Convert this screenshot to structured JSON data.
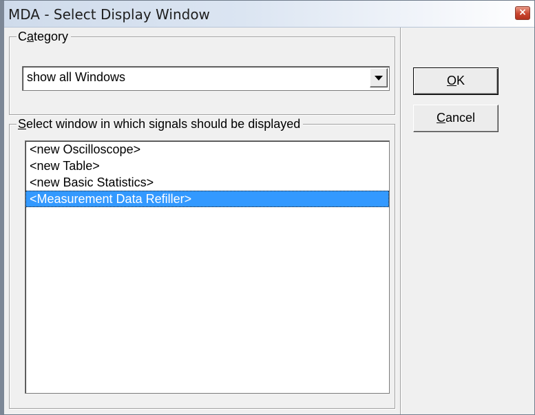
{
  "window": {
    "title": "MDA - Select Display Window",
    "close_glyph": "×"
  },
  "category": {
    "label_prefix": "C",
    "label_mnemonic": "a",
    "label_rest": "tegory",
    "selected_value": "show all Windows"
  },
  "select_window": {
    "label_mnemonic": "S",
    "label_rest": "elect window in which signals should be displayed",
    "items": [
      "<new Oscilloscope>",
      "<new Table>",
      "<new Basic Statistics>",
      "<Measurement Data Refiller>"
    ],
    "selected_index": 3
  },
  "buttons": {
    "ok_mnemonic": "O",
    "ok_rest": "K",
    "cancel_mnemonic": "C",
    "cancel_rest": "ancel"
  },
  "icons": {
    "close": "close-icon",
    "dropdown": "chevron-down-icon"
  },
  "colors": {
    "selection": "#3399ff",
    "close_button": "#c9452e",
    "dialog_background": "#f0f0f0"
  }
}
